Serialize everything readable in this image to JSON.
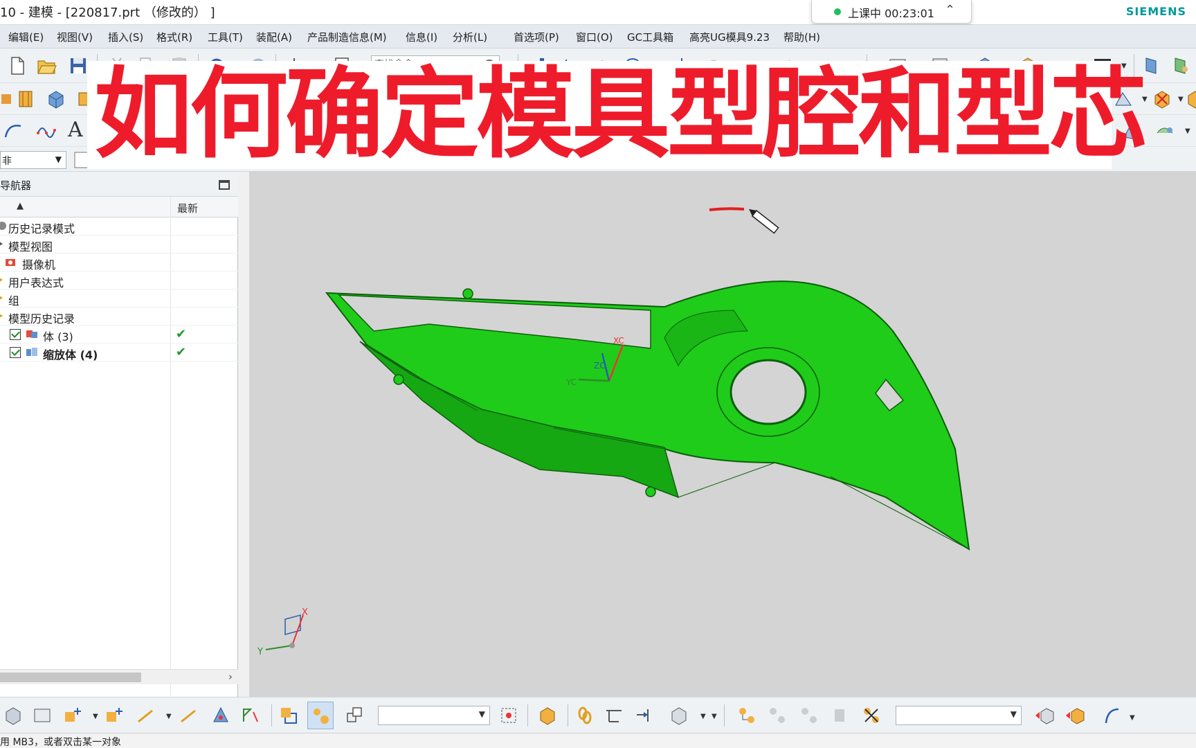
{
  "window": {
    "title": "10 - 建模 - [220817.prt （修改的） ]",
    "brand": "SIEMENS"
  },
  "class_timer": {
    "status": "上课中",
    "elapsed": "00:23:01"
  },
  "menubar": {
    "items": [
      "编辑(E)",
      "视图(V)",
      "插入(S)",
      "格式(R)",
      "工具(T)",
      "装配(A)",
      "产品制造信息(M)",
      "信息(I)",
      "分析(L)",
      "首选项(P)",
      "窗口(O)",
      "GC工具箱",
      "高亮UG模具9.23",
      "帮助(H)"
    ]
  },
  "toolbar": {
    "search_placeholder": "查找命令",
    "filter_value": "非"
  },
  "headline": "如何确定模具型腔和型芯",
  "navigator": {
    "title": "导航器",
    "column_latest": "最新",
    "rows": [
      {
        "label": "历史记录模式",
        "latest": ""
      },
      {
        "label": "模型视图",
        "latest": ""
      },
      {
        "label": "摄像机",
        "latest": ""
      },
      {
        "label": "用户表达式",
        "latest": ""
      },
      {
        "label": "组",
        "latest": ""
      },
      {
        "label": "模型历史记录",
        "latest": ""
      },
      {
        "label": "体 (3)",
        "latest": "✔"
      },
      {
        "label": "缩放体 (4)",
        "latest": "✔"
      }
    ]
  },
  "viewport": {
    "triad_labels": {
      "x": "X",
      "y": "Y",
      "xc": "XC",
      "yc": "YC",
      "zc": "ZC"
    },
    "part_color": "#1fcc1a",
    "background_color": "#d4d4d4"
  },
  "status": {
    "prompt": "用 MB3，或者双击某一对象"
  },
  "colors": {
    "accent_red": "#ee1c2b",
    "brand_teal": "#009999",
    "check_green": "#1e9a2e"
  }
}
